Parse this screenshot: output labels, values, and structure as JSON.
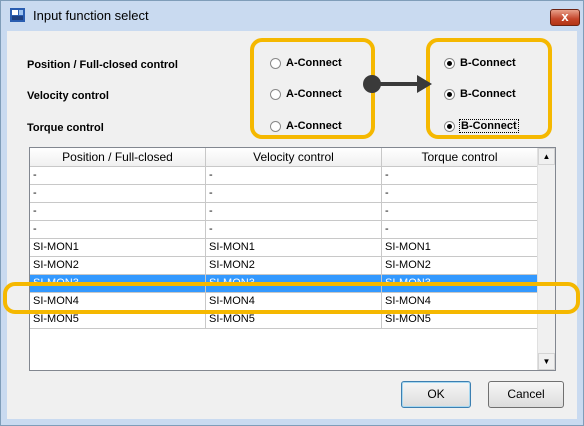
{
  "window": {
    "title": "Input function select",
    "close_glyph": "x"
  },
  "modes": {
    "position_label": "Position / Full-closed control",
    "velocity_label": "Velocity control",
    "torque_label": "Torque control",
    "a_option": "A-Connect",
    "b_option": "B-Connect",
    "selected": "B-Connect"
  },
  "table": {
    "headers": [
      "Position / Full-closed",
      "Velocity control",
      "Torque control"
    ],
    "rows": [
      [
        "-",
        "-",
        "-"
      ],
      [
        "-",
        "-",
        "-"
      ],
      [
        "-",
        "-",
        "-"
      ],
      [
        "-",
        "-",
        "-"
      ],
      [
        "SI-MON1",
        "SI-MON1",
        "SI-MON1"
      ],
      [
        "SI-MON2",
        "SI-MON2",
        "SI-MON2"
      ],
      [
        "SI-MON3",
        "SI-MON3",
        "SI-MON3"
      ],
      [
        "SI-MON4",
        "SI-MON4",
        "SI-MON4"
      ],
      [
        "SI-MON5",
        "SI-MON5",
        "SI-MON5"
      ]
    ],
    "selected_row": 6,
    "scroll_up_icon": "arrow-up-icon",
    "scroll_down_icon": "arrow-down-icon"
  },
  "buttons": {
    "ok": "OK",
    "cancel": "Cancel"
  },
  "colors": {
    "highlight": "#f5b800",
    "selection": "#3399ff",
    "arrow": "#3a3a3a"
  }
}
